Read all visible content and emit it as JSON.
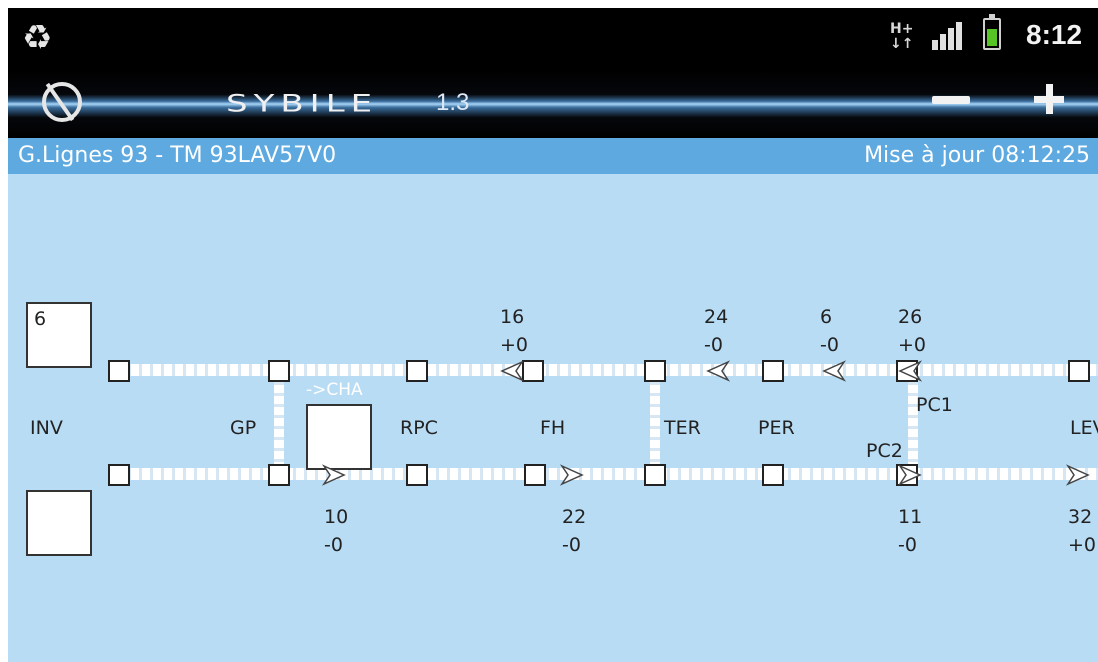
{
  "status_bar": {
    "time": "8:12",
    "network_badge": "H+",
    "icons": [
      "recycle-icon",
      "network-icon",
      "signal-icon",
      "battery-icon"
    ],
    "battery_color": "#57c426"
  },
  "app_bar": {
    "title": "SYBILE",
    "version": "1.3",
    "zoom_out_icon": "minus-icon",
    "zoom_in_icon": "plus-icon"
  },
  "info_bar": {
    "line": "G.Lignes 93 - TM 93LAV57V0",
    "updated": "Mise à jour 08:12:25"
  },
  "diagram": {
    "left_top_box": "6",
    "left_bottom_box": "",
    "transfer_label": "->CHA",
    "stations": {
      "inv": "INV",
      "gp": "GP",
      "rpc": "RPC",
      "fh": "FH",
      "ter": "TER",
      "per": "PER",
      "pc1": "PC1",
      "pc2": "PC2",
      "lev": "LEV"
    },
    "buses_up": [
      {
        "id": "16",
        "delay": "+0"
      },
      {
        "id": "24",
        "delay": "-0"
      },
      {
        "id": "6",
        "delay": "-0"
      },
      {
        "id": "26",
        "delay": "+0"
      }
    ],
    "buses_down": [
      {
        "id": "10",
        "delay": "-0"
      },
      {
        "id": "22",
        "delay": "-0"
      },
      {
        "id": "11",
        "delay": "-0"
      },
      {
        "id": "32",
        "delay": "+0"
      }
    ]
  }
}
